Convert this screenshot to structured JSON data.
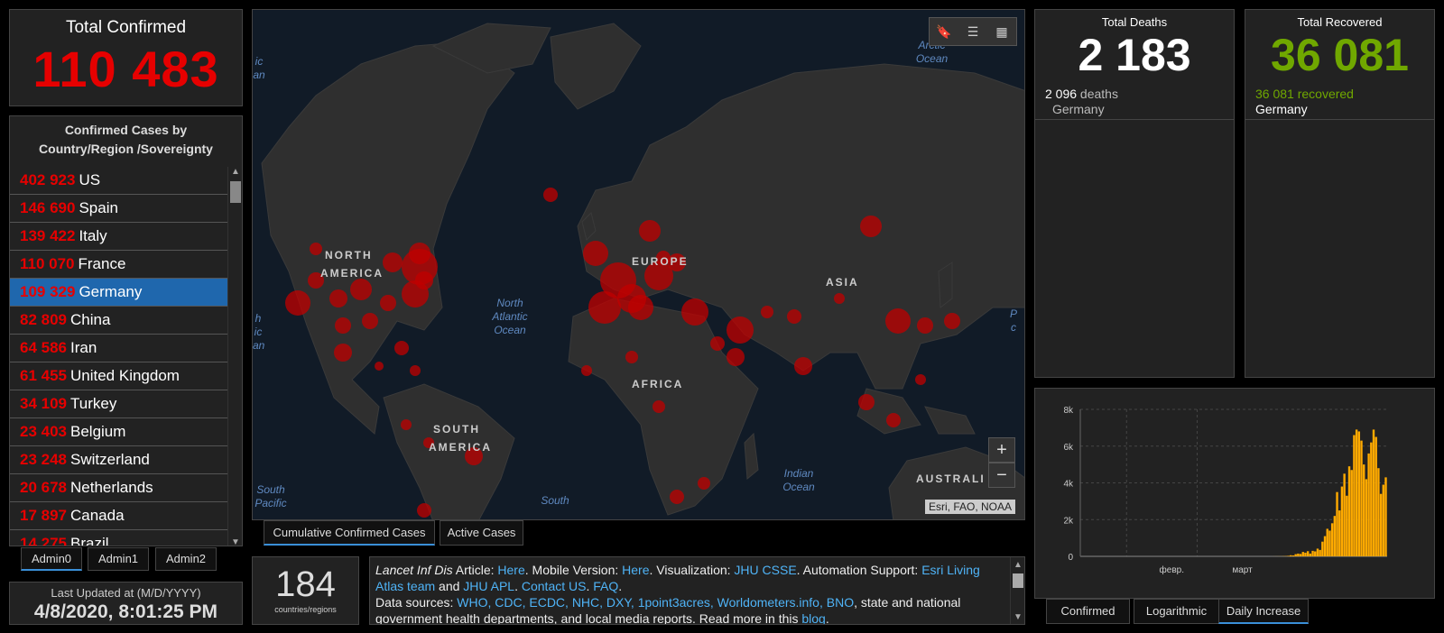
{
  "total_confirmed": {
    "title": "Total Confirmed",
    "value": "110 483"
  },
  "country_list": {
    "title": "Confirmed Cases by Country/Region /Sovereignty",
    "items": [
      {
        "count": "402 923",
        "name": "US"
      },
      {
        "count": "146 690",
        "name": "Spain"
      },
      {
        "count": "139 422",
        "name": "Italy"
      },
      {
        "count": "110 070",
        "name": "France"
      },
      {
        "count": "109 329",
        "name": "Germany",
        "selected": true
      },
      {
        "count": "82 809",
        "name": "China"
      },
      {
        "count": "64 586",
        "name": "Iran"
      },
      {
        "count": "61 455",
        "name": "United Kingdom"
      },
      {
        "count": "34 109",
        "name": "Turkey"
      },
      {
        "count": "23 403",
        "name": "Belgium"
      },
      {
        "count": "23 248",
        "name": "Switzerland"
      },
      {
        "count": "20 678",
        "name": "Netherlands"
      },
      {
        "count": "17 897",
        "name": "Canada"
      },
      {
        "count": "14 275",
        "name": "Brazil"
      }
    ]
  },
  "admin_tabs": [
    {
      "label": "Admin0",
      "active": true
    },
    {
      "label": "Admin1"
    },
    {
      "label": "Admin2"
    }
  ],
  "last_updated": {
    "label": "Last Updated at (M/D/YYYY)",
    "value": "4/8/2020, 8:01:25 PM"
  },
  "map": {
    "continent_labels": [
      "NORTH",
      "AMERICA",
      "EUROPE",
      "ASIA",
      "AFRICA",
      "SOUTH",
      "AMERICA",
      "AUSTRALI"
    ],
    "ocean_labels": [
      "North Atlantic Ocean",
      "Indian Ocean",
      "South Pacific",
      "South",
      "Arctic Ocean",
      "ic an",
      "h ic an",
      "P c"
    ],
    "attribution": "Esri, FAO, NOAA",
    "zoom_in": "+",
    "zoom_out": "−",
    "tools": [
      "bookmark-icon",
      "list-icon",
      "grid-icon"
    ]
  },
  "map_tabs": [
    {
      "label": "Cumulative Confirmed Cases",
      "active": true
    },
    {
      "label": "Active Cases"
    }
  ],
  "count": {
    "value": "184",
    "label": "countries/regions"
  },
  "info": {
    "line1_a": "Lancet Inf Dis",
    "line1_b": " Article: ",
    "line1_link1": "Here",
    "line1_c": ". Mobile Version: ",
    "line1_link2": "Here",
    "line1_d": ". Visualization: ",
    "line1_link3": "JHU CSSE",
    "line1_e": ". Automation Support: ",
    "line1_link4": "Esri Living Atlas team",
    "line1_f": " and ",
    "line1_link5": "JHU APL",
    "line1_g": ". ",
    "line1_link6": "Contact US",
    "line1_h": ". ",
    "line1_link7": "FAQ",
    "line1_i": ".",
    "line2_a": "Data sources: ",
    "line2_links": "WHO, CDC, ECDC, NHC, DXY, 1point3acres, Worldometers.info, BNO",
    "line2_b": ", state and national government health departments, and local media reports.  Read more in this ",
    "line2_link": "blog",
    "line2_c": "."
  },
  "deaths": {
    "title": "Total Deaths",
    "value": "2 183",
    "sub_num": "2 096",
    "sub_word": " deaths",
    "sub_region": "Germany"
  },
  "recovered": {
    "title": "Total Recovered",
    "value": "36 081",
    "sub_num": "36 081",
    "sub_word": " recovered",
    "sub_region": "Germany"
  },
  "chart_tabs": [
    {
      "label": "Confirmed"
    },
    {
      "label": "Logarithmic"
    },
    {
      "label": "Daily Increase",
      "active": true
    }
  ],
  "colors": {
    "confirmed": "#e60000",
    "recovered": "#70a800",
    "bar": "#ffaa00",
    "selected": "#1f67ad"
  },
  "chart_data": {
    "type": "bar",
    "ylim": [
      0,
      8000
    ],
    "yticks": [
      "0",
      "2k",
      "4k",
      "6k",
      "8k"
    ],
    "xlabels": [
      "февр.",
      "март"
    ],
    "values": [
      0,
      0,
      0,
      0,
      0,
      0,
      0,
      0,
      0,
      0,
      0,
      0,
      0,
      0,
      0,
      0,
      0,
      0,
      0,
      0,
      0,
      0,
      0,
      0,
      0,
      0,
      0,
      0,
      0,
      0,
      0,
      0,
      0,
      0,
      0,
      0,
      0,
      0,
      0,
      0,
      0,
      0,
      0,
      0,
      0,
      0,
      0,
      0,
      0,
      0,
      0,
      0,
      0,
      0,
      0,
      0,
      0,
      0,
      0,
      0,
      0,
      0,
      0,
      0,
      0,
      0,
      0,
      0,
      0,
      0,
      0,
      0,
      0,
      0,
      0,
      0,
      0,
      0,
      0,
      2,
      3,
      5,
      5,
      10,
      15,
      30,
      60,
      50,
      120,
      150,
      130,
      240,
      200,
      280,
      150,
      300,
      270,
      420,
      350,
      800,
      1100,
      1500,
      1400,
      1800,
      2200,
      3500,
      2500,
      3800,
      4500,
      3300,
      4900,
      4700,
      6600,
      6900,
      6800,
      6300,
      5000,
      4200,
      5600,
      6200,
      6900,
      6500,
      4800,
      3400,
      3900,
      4300
    ],
    "xlabel_index": [
      19,
      48
    ]
  }
}
